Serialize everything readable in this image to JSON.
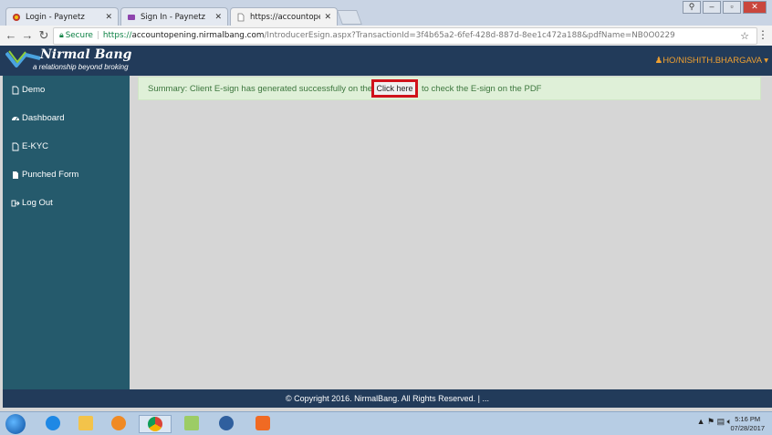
{
  "browser": {
    "tabs": [
      {
        "label": "Login - Paynetz"
      },
      {
        "label": "Sign In - Paynetz"
      },
      {
        "label": "https://accountopening.n"
      }
    ],
    "secure_label": "Secure",
    "url": {
      "protocol": "https://",
      "host": "accountopening.nirmalbang.com",
      "path": "/IntroducerEsign.aspx?TransactionId=3f4b65a2-6fef-428d-887d-8ee1c472a188&pdfName=NB0O0229"
    }
  },
  "header": {
    "brand": "Nirmal Bang",
    "tagline": "a relationship beyond broking",
    "user": "HO/NISHITH.BHARGAVA"
  },
  "sidebar": {
    "items": [
      {
        "label": "Demo",
        "icon": "file-icon"
      },
      {
        "label": "Dashboard",
        "icon": "dashboard-icon"
      },
      {
        "label": "E-KYC",
        "icon": "file-icon"
      },
      {
        "label": "Punched Form",
        "icon": "file-filled-icon"
      },
      {
        "label": "Log Out",
        "icon": "logout-icon"
      }
    ]
  },
  "alert": {
    "text_before": "Summary: Client E-sign has generated successfully on the pdf.",
    "button": "Click here",
    "text_after": "to check the E-sign on the PDF"
  },
  "footer": {
    "text": "© Copyright 2016. NirmalBang. All Rights Reserved.   |   ..."
  },
  "taskbar": {
    "time": "5:16 PM",
    "date": "07/28/2017"
  },
  "colors": {
    "header_bg": "#223b5a",
    "sidebar_bg": "#255a6c",
    "alert_bg": "#dff0d8",
    "alert_text": "#3c763d",
    "highlight": "#d0121b",
    "user_text": "#f0a030"
  }
}
